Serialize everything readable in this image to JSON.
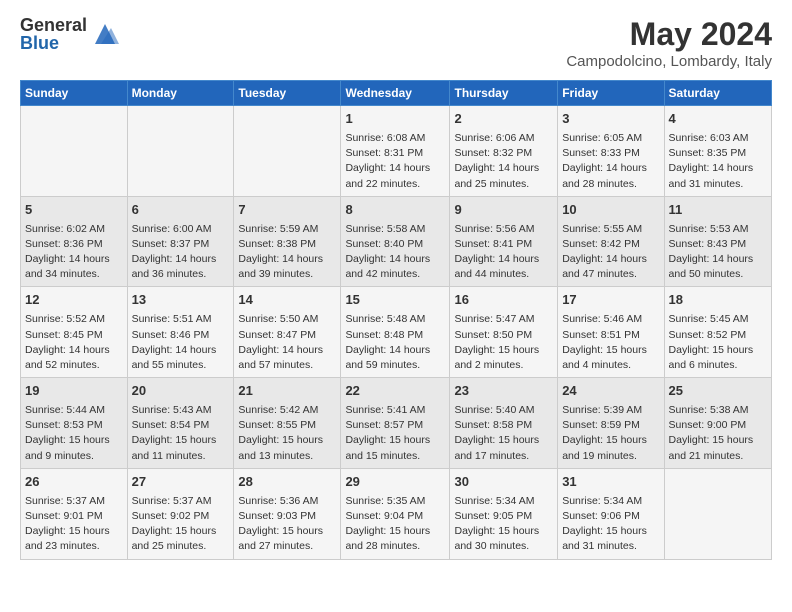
{
  "logo": {
    "general": "General",
    "blue": "Blue"
  },
  "header": {
    "month_year": "May 2024",
    "location": "Campodolcino, Lombardy, Italy"
  },
  "days_of_week": [
    "Sunday",
    "Monday",
    "Tuesday",
    "Wednesday",
    "Thursday",
    "Friday",
    "Saturday"
  ],
  "weeks": [
    [
      {
        "day": "",
        "info": ""
      },
      {
        "day": "",
        "info": ""
      },
      {
        "day": "",
        "info": ""
      },
      {
        "day": "1",
        "info": "Sunrise: 6:08 AM\nSunset: 8:31 PM\nDaylight: 14 hours\nand 22 minutes."
      },
      {
        "day": "2",
        "info": "Sunrise: 6:06 AM\nSunset: 8:32 PM\nDaylight: 14 hours\nand 25 minutes."
      },
      {
        "day": "3",
        "info": "Sunrise: 6:05 AM\nSunset: 8:33 PM\nDaylight: 14 hours\nand 28 minutes."
      },
      {
        "day": "4",
        "info": "Sunrise: 6:03 AM\nSunset: 8:35 PM\nDaylight: 14 hours\nand 31 minutes."
      }
    ],
    [
      {
        "day": "5",
        "info": "Sunrise: 6:02 AM\nSunset: 8:36 PM\nDaylight: 14 hours\nand 34 minutes."
      },
      {
        "day": "6",
        "info": "Sunrise: 6:00 AM\nSunset: 8:37 PM\nDaylight: 14 hours\nand 36 minutes."
      },
      {
        "day": "7",
        "info": "Sunrise: 5:59 AM\nSunset: 8:38 PM\nDaylight: 14 hours\nand 39 minutes."
      },
      {
        "day": "8",
        "info": "Sunrise: 5:58 AM\nSunset: 8:40 PM\nDaylight: 14 hours\nand 42 minutes."
      },
      {
        "day": "9",
        "info": "Sunrise: 5:56 AM\nSunset: 8:41 PM\nDaylight: 14 hours\nand 44 minutes."
      },
      {
        "day": "10",
        "info": "Sunrise: 5:55 AM\nSunset: 8:42 PM\nDaylight: 14 hours\nand 47 minutes."
      },
      {
        "day": "11",
        "info": "Sunrise: 5:53 AM\nSunset: 8:43 PM\nDaylight: 14 hours\nand 50 minutes."
      }
    ],
    [
      {
        "day": "12",
        "info": "Sunrise: 5:52 AM\nSunset: 8:45 PM\nDaylight: 14 hours\nand 52 minutes."
      },
      {
        "day": "13",
        "info": "Sunrise: 5:51 AM\nSunset: 8:46 PM\nDaylight: 14 hours\nand 55 minutes."
      },
      {
        "day": "14",
        "info": "Sunrise: 5:50 AM\nSunset: 8:47 PM\nDaylight: 14 hours\nand 57 minutes."
      },
      {
        "day": "15",
        "info": "Sunrise: 5:48 AM\nSunset: 8:48 PM\nDaylight: 14 hours\nand 59 minutes."
      },
      {
        "day": "16",
        "info": "Sunrise: 5:47 AM\nSunset: 8:50 PM\nDaylight: 15 hours\nand 2 minutes."
      },
      {
        "day": "17",
        "info": "Sunrise: 5:46 AM\nSunset: 8:51 PM\nDaylight: 15 hours\nand 4 minutes."
      },
      {
        "day": "18",
        "info": "Sunrise: 5:45 AM\nSunset: 8:52 PM\nDaylight: 15 hours\nand 6 minutes."
      }
    ],
    [
      {
        "day": "19",
        "info": "Sunrise: 5:44 AM\nSunset: 8:53 PM\nDaylight: 15 hours\nand 9 minutes."
      },
      {
        "day": "20",
        "info": "Sunrise: 5:43 AM\nSunset: 8:54 PM\nDaylight: 15 hours\nand 11 minutes."
      },
      {
        "day": "21",
        "info": "Sunrise: 5:42 AM\nSunset: 8:55 PM\nDaylight: 15 hours\nand 13 minutes."
      },
      {
        "day": "22",
        "info": "Sunrise: 5:41 AM\nSunset: 8:57 PM\nDaylight: 15 hours\nand 15 minutes."
      },
      {
        "day": "23",
        "info": "Sunrise: 5:40 AM\nSunset: 8:58 PM\nDaylight: 15 hours\nand 17 minutes."
      },
      {
        "day": "24",
        "info": "Sunrise: 5:39 AM\nSunset: 8:59 PM\nDaylight: 15 hours\nand 19 minutes."
      },
      {
        "day": "25",
        "info": "Sunrise: 5:38 AM\nSunset: 9:00 PM\nDaylight: 15 hours\nand 21 minutes."
      }
    ],
    [
      {
        "day": "26",
        "info": "Sunrise: 5:37 AM\nSunset: 9:01 PM\nDaylight: 15 hours\nand 23 minutes."
      },
      {
        "day": "27",
        "info": "Sunrise: 5:37 AM\nSunset: 9:02 PM\nDaylight: 15 hours\nand 25 minutes."
      },
      {
        "day": "28",
        "info": "Sunrise: 5:36 AM\nSunset: 9:03 PM\nDaylight: 15 hours\nand 27 minutes."
      },
      {
        "day": "29",
        "info": "Sunrise: 5:35 AM\nSunset: 9:04 PM\nDaylight: 15 hours\nand 28 minutes."
      },
      {
        "day": "30",
        "info": "Sunrise: 5:34 AM\nSunset: 9:05 PM\nDaylight: 15 hours\nand 30 minutes."
      },
      {
        "day": "31",
        "info": "Sunrise: 5:34 AM\nSunset: 9:06 PM\nDaylight: 15 hours\nand 31 minutes."
      },
      {
        "day": "",
        "info": ""
      }
    ]
  ]
}
